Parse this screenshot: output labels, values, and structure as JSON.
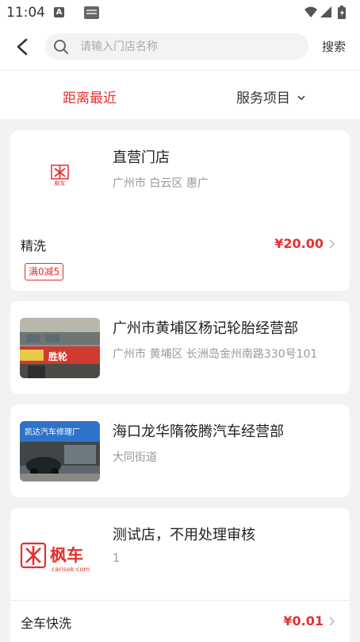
{
  "status_bar": {
    "time": "11:04",
    "a_icon": "A"
  },
  "header": {
    "search_placeholder": "请输入门店名称",
    "search_button": "搜索"
  },
  "filter": {
    "nearest": "距离最近",
    "service": "服务项目"
  },
  "stores": [
    {
      "name": "直营门店",
      "address": "广州市 白云区 惠广",
      "logo_text": "枫车",
      "services": [
        {
          "name": "精洗",
          "price": "¥20.00"
        }
      ],
      "coupon": "满0减5"
    },
    {
      "name": "广州市黄埔区杨记轮胎经营部",
      "address": "广州市 黄埔区 长洲岛金州南路330号101",
      "photo_sign": "胜轮"
    },
    {
      "name": "海口龙华隋筱腾汽车经营部",
      "address": "大同街道",
      "photo_sign": "凯达汽车修理厂"
    },
    {
      "name": "测试店，不用处理审核",
      "address": "1",
      "logo_text": "枫车",
      "logo_sub": "carisok·com",
      "services": [
        {
          "name": "全车快洗",
          "price": "¥0.01"
        }
      ]
    }
  ],
  "colors": {
    "accent": "#e4312f",
    "muted": "#999999",
    "background": "#f2f2f2"
  }
}
